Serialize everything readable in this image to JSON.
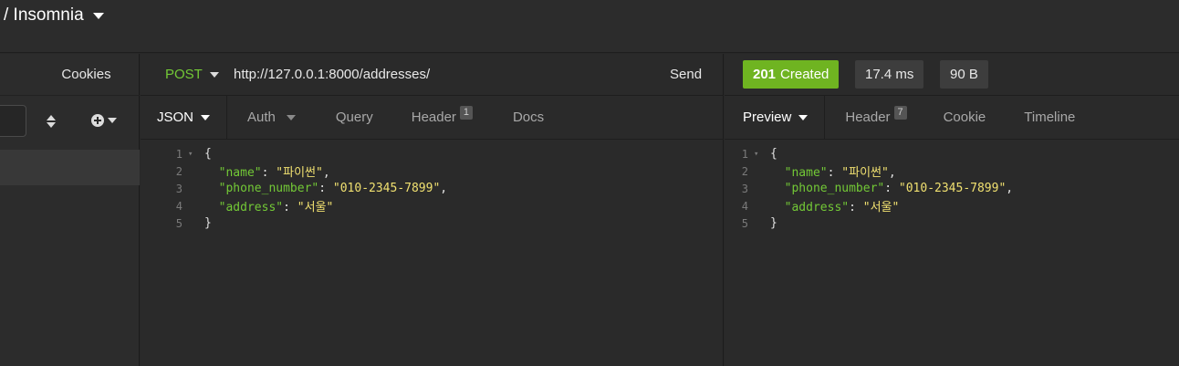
{
  "window": {
    "title": "/ Insomnia"
  },
  "sidebar": {
    "cookies_label": "Cookies"
  },
  "request": {
    "method": "POST",
    "url": "http://127.0.0.1:8000/addresses/",
    "send_label": "Send",
    "tabs": [
      {
        "label": "JSON",
        "active": true
      },
      {
        "label": "Auth"
      },
      {
        "label": "Query"
      },
      {
        "label": "Header",
        "badge": "1"
      },
      {
        "label": "Docs"
      }
    ],
    "body_lines": [
      {
        "num": "1",
        "fold": true,
        "text": "{"
      },
      {
        "num": "2",
        "key": "\"name\"",
        "value": "\"파이썬\"",
        "comma": ","
      },
      {
        "num": "3",
        "key": "\"phone_number\"",
        "value": "\"010-2345-7899\"",
        "comma": ","
      },
      {
        "num": "4",
        "key": "\"address\"",
        "value": "\"서울\"",
        "comma": ""
      },
      {
        "num": "5",
        "text": "}"
      }
    ]
  },
  "response": {
    "status_code": "201",
    "status_text": "Created",
    "time": "17.4 ms",
    "size": "90 B",
    "tabs": [
      {
        "label": "Preview",
        "active": true
      },
      {
        "label": "Header",
        "badge": "7"
      },
      {
        "label": "Cookie"
      },
      {
        "label": "Timeline"
      }
    ],
    "body_lines": [
      {
        "num": "1",
        "fold": true,
        "text": "{"
      },
      {
        "num": "2",
        "key": "\"name\"",
        "value": "\"파이썬\"",
        "comma": ","
      },
      {
        "num": "3",
        "key": "\"phone_number\"",
        "value": "\"010-2345-7899\"",
        "comma": ","
      },
      {
        "num": "4",
        "key": "\"address\"",
        "value": "\"서울\"",
        "comma": ""
      },
      {
        "num": "5",
        "text": "}"
      }
    ]
  },
  "colors": {
    "method_post": "#73c936",
    "status_success": "#6fb421",
    "json_key": "#73c936",
    "json_string": "#f0e070"
  }
}
